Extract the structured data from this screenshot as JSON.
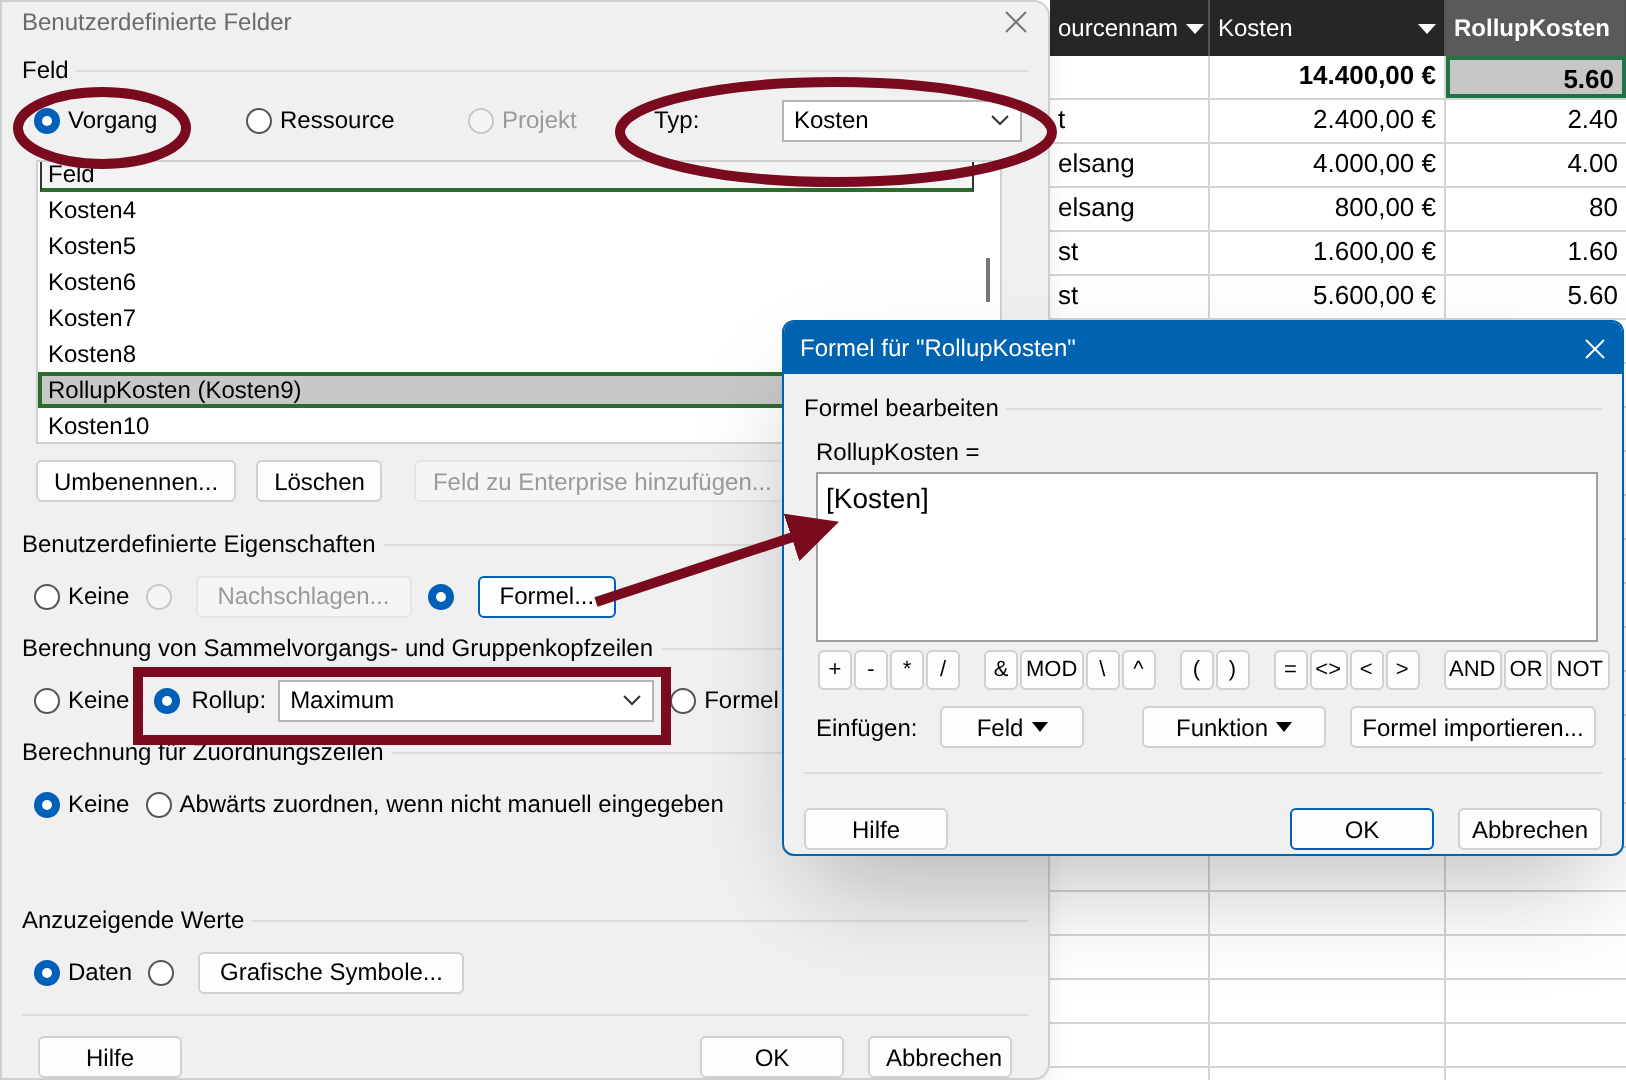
{
  "sheet": {
    "columns": [
      {
        "label": "ourcennam",
        "filter": true,
        "selected": false
      },
      {
        "label": "Kosten",
        "filter": true,
        "selected": false
      },
      {
        "label": "RollupKosten",
        "filter": false,
        "selected": true
      }
    ],
    "rows": [
      {
        "kind": "summary",
        "cost": "14.400,00 €",
        "rollup": "5.60",
        "selected": true
      },
      {
        "kind": "task",
        "resource": "t",
        "cost": "2.400,00 €",
        "rollup": "2.40",
        "selected": false
      },
      {
        "kind": "task",
        "resource": "elsang",
        "cost": "4.000,00 €",
        "rollup": "4.00",
        "selected": false
      },
      {
        "kind": "task",
        "resource": "elsang",
        "cost": "800,00 €",
        "rollup": "80",
        "selected": false
      },
      {
        "kind": "task",
        "resource": "st",
        "cost": "1.600,00 €",
        "rollup": "1.60",
        "selected": false
      },
      {
        "kind": "task",
        "resource": "st",
        "cost": "5.600,00 €",
        "rollup": "5.60",
        "selected": false
      }
    ]
  },
  "main_dialog": {
    "title": "Benutzerdefinierte Felder",
    "field_group": {
      "label": "Feld",
      "entity_options": [
        {
          "label": "Vorgang",
          "selected": true,
          "disabled": false
        },
        {
          "label": "Ressource",
          "selected": false,
          "disabled": false
        },
        {
          "label": "Projekt",
          "selected": false,
          "disabled": true
        }
      ],
      "type_label": "Typ:",
      "type_value": "Kosten",
      "list_header": "Feld",
      "fields": [
        {
          "name": "Kosten4",
          "selected": false
        },
        {
          "name": "Kosten5",
          "selected": false
        },
        {
          "name": "Kosten6",
          "selected": false
        },
        {
          "name": "Kosten7",
          "selected": false
        },
        {
          "name": "Kosten8",
          "selected": false
        },
        {
          "name": "RollupKosten (Kosten9)",
          "selected": true
        },
        {
          "name": "Kosten10",
          "selected": false
        }
      ],
      "buttons": [
        {
          "label": "Umbenennen...",
          "disabled": false
        },
        {
          "label": "Löschen",
          "disabled": false
        },
        {
          "label": "Feld zu Enterprise hinzufügen...",
          "disabled": true
        }
      ]
    },
    "sections": [
      {
        "label": "Benutzerdefinierte Eigenschaften",
        "options": [
          {
            "kind": "radio",
            "label": "Keine",
            "selected": false,
            "disabled": false
          },
          {
            "kind": "radio-button",
            "button": "Nachschlagen...",
            "selected": false,
            "disabled": true
          },
          {
            "kind": "radio-button",
            "button": "Formel...",
            "selected": true,
            "disabled": false
          }
        ]
      },
      {
        "label": "Berechnung von Sammelvorgangs- und Gruppenkopfzeilen",
        "options": [
          {
            "kind": "radio",
            "label": "Keine",
            "selected": false,
            "disabled": false
          },
          {
            "kind": "radio-select",
            "label": "Rollup:",
            "value": "Maximum",
            "selected": true,
            "disabled": false
          },
          {
            "kind": "radio",
            "label": "Formel",
            "selected": false,
            "disabled": false
          }
        ]
      },
      {
        "label": "Berechnung für Zuordnungszeilen",
        "options": [
          {
            "kind": "radio",
            "label": "Keine",
            "selected": true,
            "disabled": false
          },
          {
            "kind": "radio",
            "label": "Abwärts zuordnen, wenn nicht manuell eingegeben",
            "selected": false,
            "disabled": false
          }
        ]
      },
      {
        "label": "Anzuzeigende Werte",
        "options": [
          {
            "kind": "radio",
            "label": "Daten",
            "selected": true,
            "disabled": false
          },
          {
            "kind": "radio-button",
            "button": "Grafische Symbole...",
            "selected": false,
            "disabled": false
          }
        ]
      }
    ],
    "footer_buttons": [
      "Hilfe",
      "OK",
      "Abbrechen"
    ]
  },
  "formula_dialog": {
    "title": "Formel für \"RollupKosten\"",
    "group_label": "Formel bearbeiten",
    "field_label": "RollupKosten =",
    "formula": "[Kosten]",
    "operator_groups": [
      [
        "+",
        "-",
        "*",
        "/"
      ],
      [
        "&",
        "MOD",
        "\\",
        "^"
      ],
      [
        "(",
        ")"
      ],
      [
        "=",
        "<>",
        "<",
        ">"
      ],
      [
        "AND",
        "OR",
        "NOT"
      ]
    ],
    "insert_label": "Einfügen:",
    "insert_buttons": [
      {
        "label": "Feld",
        "dropdown": true
      },
      {
        "label": "Funktion",
        "dropdown": true
      },
      {
        "label": "Formel importieren...",
        "dropdown": false
      }
    ],
    "footer_buttons": [
      {
        "label": "Hilfe",
        "default": false
      },
      {
        "label": "OK",
        "default": true
      },
      {
        "label": "Abbrechen",
        "default": false
      }
    ]
  }
}
